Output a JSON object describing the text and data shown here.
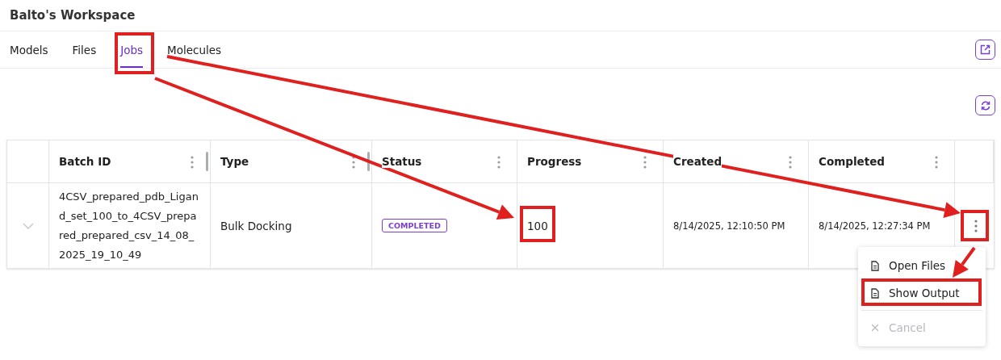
{
  "workspace": {
    "title": "Balto's Workspace"
  },
  "tabs": [
    {
      "label": "Models",
      "selected": false
    },
    {
      "label": "Files",
      "selected": false
    },
    {
      "label": "Jobs",
      "selected": true
    },
    {
      "label": "Molecules",
      "selected": false
    }
  ],
  "table": {
    "columns": [
      {
        "label": "Batch ID",
        "resizable": true
      },
      {
        "label": "Type",
        "resizable": true
      },
      {
        "label": "Status",
        "resizable": false
      },
      {
        "label": "Progress",
        "resizable": false
      },
      {
        "label": "Created",
        "resizable": false
      },
      {
        "label": "Completed",
        "resizable": false
      }
    ],
    "rows": [
      {
        "expanded": false,
        "batch_id": "4CSV_prepared_pdb_Ligand_set_100_to_4CSV_prepared_prepared_csv_14_08_2025_19_10_49",
        "type": "Bulk Docking",
        "status": "COMPLETED",
        "progress": "100",
        "created": "8/14/2025, 12:10:50 PM",
        "completed": "8/14/2025, 12:27:34 PM"
      }
    ]
  },
  "row_menu": {
    "groups": [
      [
        {
          "label": "Open Files",
          "kind": "file",
          "disabled": false
        },
        {
          "label": "Show Output",
          "kind": "file",
          "disabled": false
        }
      ],
      [
        {
          "label": "Cancel",
          "kind": "cancel",
          "disabled": true
        }
      ]
    ]
  }
}
